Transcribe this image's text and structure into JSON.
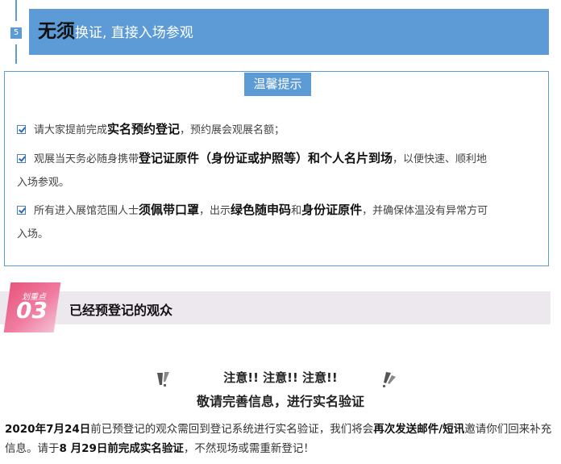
{
  "section5": {
    "number": "5",
    "title_bold": "无须",
    "title_rest": "换证, 直接入场参观"
  },
  "tips": {
    "title": "温馨提示",
    "items": [
      {
        "lines": [
          [
            {
              "t": "请大家提前完成",
              "b": false
            },
            {
              "t": "实名预约登记",
              "b": true
            },
            {
              "t": "，预约展会观展名额；",
              "b": false
            }
          ]
        ]
      },
      {
        "lines": [
          [
            {
              "t": "观展当天务必随身携带",
              "b": false
            },
            {
              "t": "登记证原件（身份证或护照等）和个人名片到场",
              "b": true
            },
            {
              "t": "，以便快速、顺利地",
              "b": false
            }
          ],
          [
            {
              "t": "入场参观。",
              "b": false
            }
          ]
        ]
      },
      {
        "lines": [
          [
            {
              "t": "所有进入展馆范围人士",
              "b": false
            },
            {
              "t": "须佩带口罩",
              "b": true
            },
            {
              "t": "，出示",
              "b": false
            },
            {
              "t": "绿色随申码",
              "b": true
            },
            {
              "t": "和",
              "b": false
            },
            {
              "t": "身份证原件",
              "b": true
            },
            {
              "t": "，并确保体温没有异常方可",
              "b": false
            }
          ],
          [
            {
              "t": "入场。",
              "b": false
            }
          ]
        ]
      }
    ]
  },
  "section03": {
    "badge_sub": "划重点",
    "badge_num": "03",
    "heading": "已经预登记的观众"
  },
  "notice": {
    "line1": "注意!! 注意!! 注意!!",
    "line2": "敬请完善信息，进行实名验证"
  },
  "paragraph": [
    {
      "t": "2020年7月24日",
      "b": true
    },
    {
      "t": "前已预登记的观众需回到登记系统进行实名验证，我们将会",
      "b": false
    },
    {
      "t": "再次发送邮件/短讯",
      "b": true
    },
    {
      "t": "邀请你们回来补充信息。请于",
      "b": false
    },
    {
      "t": "8 月29日前完成实名验证",
      "b": true
    },
    {
      "t": "，不然现场或需重新登记！",
      "b": false
    }
  ],
  "colors": {
    "accent_blue": "#5c9bd6",
    "pink": "#e8557c",
    "bar_gray": "#ede7ee"
  }
}
